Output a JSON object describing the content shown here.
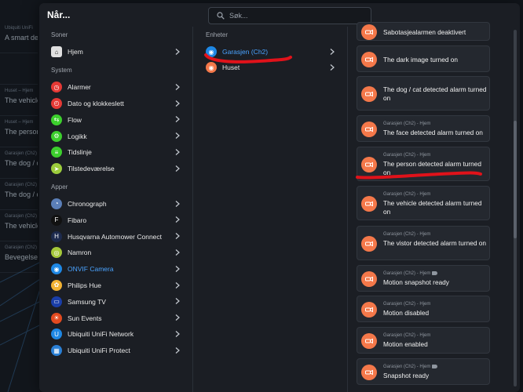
{
  "modal": {
    "title": "Når...",
    "search_placeholder": "Søk..."
  },
  "background": {
    "items": [
      {
        "meta": "Ubiquiti UniFi",
        "text": "A smart det"
      },
      {
        "meta": "",
        "text": ""
      },
      {
        "meta": "Huset – Hjem",
        "text": "The vehicle"
      },
      {
        "meta": "Huset – Hjem",
        "text": "The person"
      },
      {
        "meta": "Garasjen (Ch2)",
        "text": "The dog / c"
      },
      {
        "meta": "Garasjen (Ch2)",
        "text": "The dog / c"
      },
      {
        "meta": "Garasjen (Ch2)",
        "text": "The vehicle"
      },
      {
        "meta": "Garasjen (Ch2)",
        "text": "Bevegelses"
      }
    ]
  },
  "left": {
    "sections": [
      {
        "label": "Soner",
        "items": [
          {
            "label": "Hjem",
            "icon": "home-icon",
            "color": "#e0e0e0"
          }
        ]
      },
      {
        "label": "System",
        "items": [
          {
            "label": "Alarmer",
            "icon": "alarm-icon",
            "color": "#e53935"
          },
          {
            "label": "Dato og klokkeslett",
            "icon": "clock-icon",
            "color": "#e53935"
          },
          {
            "label": "Flow",
            "icon": "flow-icon",
            "color": "#3ccf2d"
          },
          {
            "label": "Logikk",
            "icon": "logic-icon",
            "color": "#3ccf2d"
          },
          {
            "label": "Tidslinje",
            "icon": "timeline-icon",
            "color": "#3ccf2d"
          },
          {
            "label": "Tilstedeværelse",
            "icon": "presence-icon",
            "color": "#9ccc3c"
          }
        ]
      },
      {
        "label": "Apper",
        "items": [
          {
            "label": "Chronograph",
            "icon": "chronograph-icon",
            "color": "#5b7fb8"
          },
          {
            "label": "Fibaro",
            "icon": "fibaro-icon",
            "color": "#111111"
          },
          {
            "label": "Husqvarna Automower Connect",
            "icon": "husqvarna-icon",
            "color": "#1d2a4d"
          },
          {
            "label": "Namron",
            "icon": "namron-icon",
            "color": "#a5c83a"
          },
          {
            "label": "ONVIF Camera",
            "icon": "onvif-icon",
            "color": "#1e88e5",
            "active": true
          },
          {
            "label": "Philips Hue",
            "icon": "hue-icon",
            "color": "#f2b233"
          },
          {
            "label": "Samsung TV",
            "icon": "samsung-icon",
            "color": "#1a3ea8"
          },
          {
            "label": "Sun Events",
            "icon": "sun-icon",
            "color": "#e24a1f"
          },
          {
            "label": "Ubiquiti UniFi Network",
            "icon": "unifi-icon",
            "color": "#1e88e5"
          },
          {
            "label": "Ubiquiti UniFi Protect",
            "icon": "unifi-protect-icon",
            "color": "#2a7fd4"
          }
        ]
      }
    ]
  },
  "middle": {
    "label": "Enheter",
    "items": [
      {
        "label": "Garasjen (Ch2)",
        "active": true,
        "color": "#1e88e5"
      },
      {
        "label": "Huset",
        "active": false,
        "color": "#f4784a"
      }
    ]
  },
  "right": {
    "cards": [
      {
        "meta": "",
        "text": "Sabotasjealarmen deaktivert",
        "tag": false
      },
      {
        "meta": "",
        "text": "The dark image turned on",
        "tag": false
      },
      {
        "meta": "",
        "text": "The dog / cat detected alarm turned on",
        "tag": false
      },
      {
        "meta": "Garasjen (Ch2) - Hjem",
        "text": "The face detected alarm turned on",
        "tag": false
      },
      {
        "meta": "Garasjen (Ch2) - Hjem",
        "text": "The person detected alarm turned on",
        "tag": false
      },
      {
        "meta": "Garasjen (Ch2) - Hjem",
        "text": "The vehicle detected alarm turned on",
        "tag": false
      },
      {
        "meta": "Garasjen (Ch2) - Hjem",
        "text": "The vistor detected alarm turned on",
        "tag": false
      },
      {
        "meta": "Garasjen (Ch2) - Hjem",
        "text": "Motion snapshot ready",
        "tag": true
      },
      {
        "meta": "Garasjen (Ch2) - Hjem",
        "text": "Motion disabled",
        "tag": false
      },
      {
        "meta": "Garasjen (Ch2) - Hjem",
        "text": "Motion enabled",
        "tag": false
      },
      {
        "meta": "Garasjen (Ch2) - Hjem",
        "text": "Snapshot ready",
        "tag": true
      }
    ]
  },
  "colors": {
    "accent": "#4aa3ff",
    "card_icon": "#f4784a",
    "annotation": "#e0121a"
  }
}
